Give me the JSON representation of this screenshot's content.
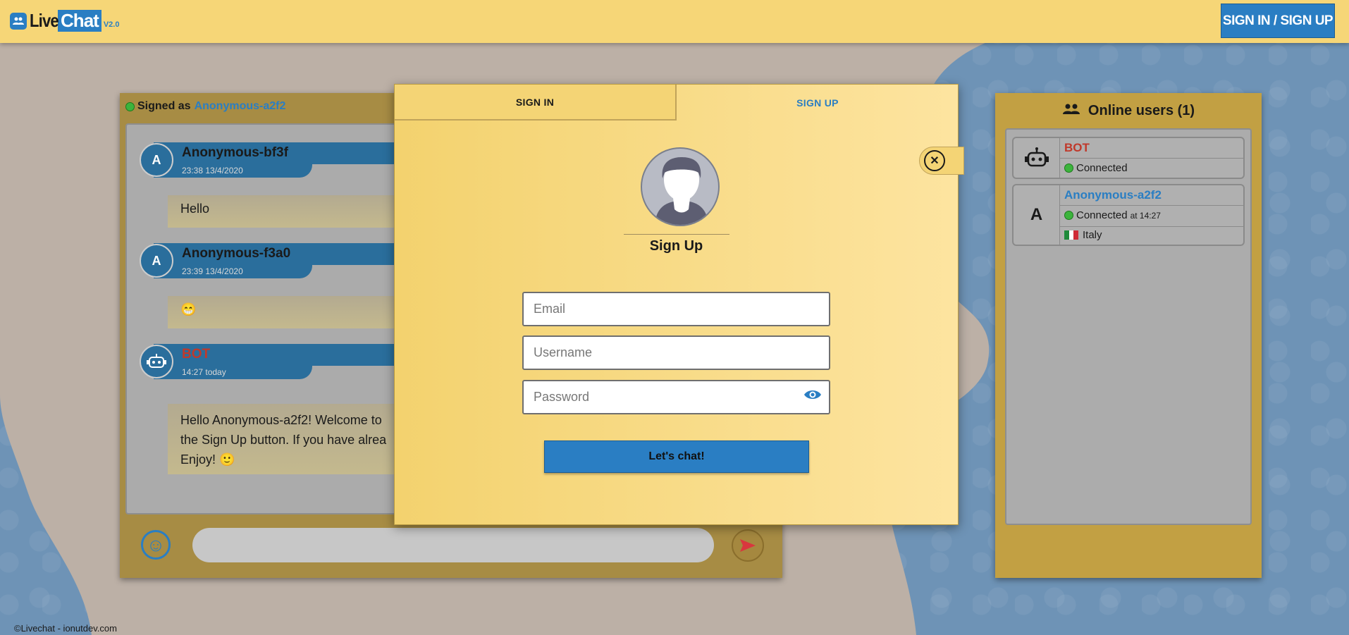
{
  "header": {
    "logo_live": "Live",
    "logo_chat": "Chat",
    "logo_version": "V2.0",
    "signin_button": "SIGN IN / SIGN UP"
  },
  "chat": {
    "signed_as_label": "Signed as",
    "signed_user": "Anonymous-a2f2",
    "messages": [
      {
        "avatar": "A",
        "name": "Anonymous-bf3f",
        "time": "23:38 13/4/2020",
        "text": "Hello"
      },
      {
        "avatar": "A",
        "name": "Anonymous-f3a0",
        "time": "23:39 13/4/2020",
        "text": "😁"
      },
      {
        "avatar": "robot-icon",
        "name": "BOT",
        "time": "14:27 today",
        "text": "Hello Anonymous-a2f2! Welcome to",
        "text2": "the Sign Up button. If you have alrea",
        "text3": "Enjoy! 🙂"
      }
    ]
  },
  "users": {
    "title": "Online users (1)",
    "list": [
      {
        "name": "BOT",
        "status": "Connected"
      },
      {
        "avatar": "A",
        "name": "Anonymous-a2f2",
        "status": "Connected",
        "status_at": "at 14:27",
        "country": "Italy"
      }
    ]
  },
  "modal": {
    "tab_signin": "SIGN IN",
    "tab_signup": "SIGN UP",
    "active_tab": "SIGN UP",
    "title": "Sign Up",
    "email_placeholder": "Email",
    "username_placeholder": "Username",
    "password_placeholder": "Password",
    "submit": "Let's chat!"
  },
  "footer": {
    "text": "©Livechat - ionutdev.com"
  },
  "colors": {
    "accent": "#2a7ec3",
    "header": "#f6d677",
    "bot_name": "#c0392b",
    "online_dot": "#3cb43c"
  }
}
